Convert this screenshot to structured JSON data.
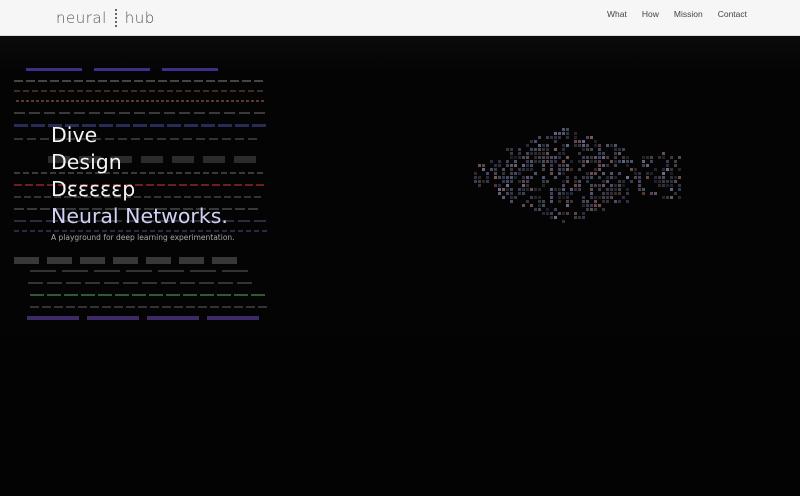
{
  "brand": {
    "name_left": "neural",
    "name_right": "hub",
    "mark_icon": "dotted-divider-icon"
  },
  "nav": {
    "items": [
      {
        "label": "What"
      },
      {
        "label": "How"
      },
      {
        "label": "Mission"
      },
      {
        "label": "Contact"
      }
    ]
  },
  "hero": {
    "lines": [
      "Dive",
      "Design",
      "Dεεεεεp",
      "Neural Networks."
    ],
    "tagline": "A playground for deep learning experimentation.",
    "colors": {
      "background": "#030303",
      "headline": "#f4f4f4",
      "accent": "#cfd2f4"
    }
  },
  "visuals": {
    "left_pattern_icon": "layered-dash-pattern-icon",
    "right_pattern_icon": "neural-network-pixel-icon"
  }
}
